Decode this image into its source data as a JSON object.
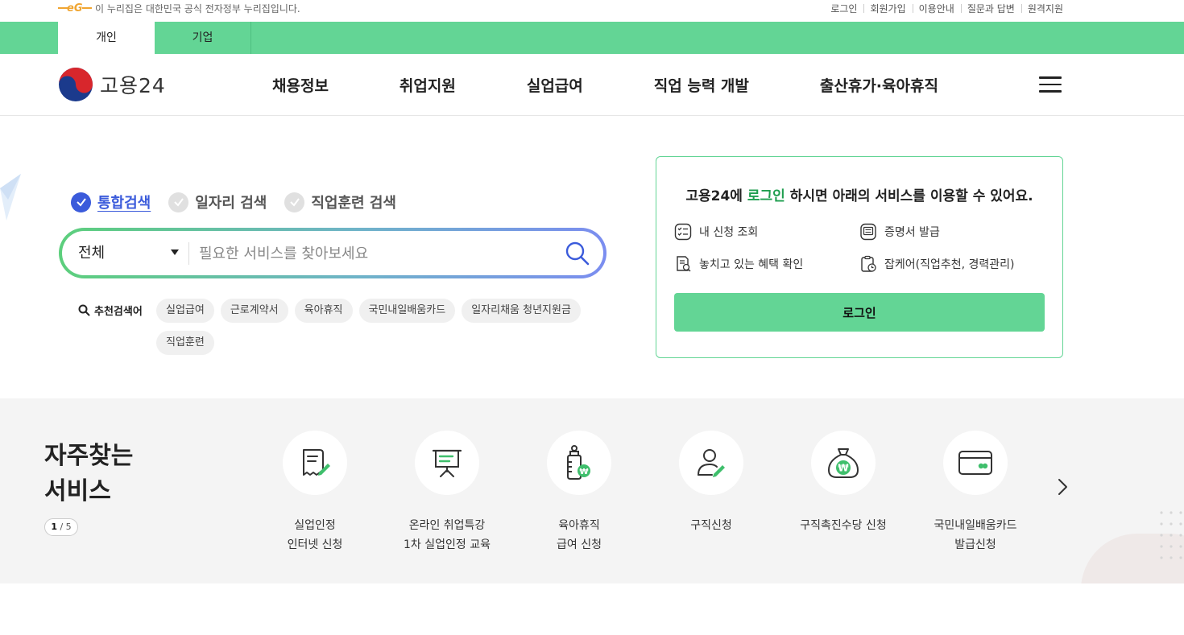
{
  "gov_bar": {
    "logo_text": "eG",
    "notice": "이 누리집은 대한민국 공식 전자정부 누리집입니다.",
    "links": [
      "로그인",
      "회원가입",
      "이용안내",
      "질문과 답변",
      "원격지원"
    ]
  },
  "audience_tabs": {
    "personal": "개인",
    "business": "기업"
  },
  "header": {
    "brand": "고용24",
    "nav": [
      "채용정보",
      "취업지원",
      "실업급여",
      "직업 능력 개발",
      "출산휴가·육아휴직"
    ]
  },
  "search": {
    "tabs": [
      "통합검색",
      "일자리 검색",
      "직업훈련 검색"
    ],
    "active_tab": "통합검색",
    "select_value": "전체",
    "placeholder": "필요한 서비스를 찾아보세요",
    "recommended_label": "추천검색어",
    "recommended_tags": [
      "실업급여",
      "근로계약서",
      "육아휴직",
      "국민내일배움카드",
      "일자리채움 청년지원금",
      "직업훈련"
    ]
  },
  "login_card": {
    "msg_prefix": "고용24에 ",
    "msg_highlight": "로그인",
    "msg_suffix": " 하시면 아래의 서비스를 이용할 수 있어요.",
    "services": [
      "내 신청 조회",
      "증명서 발급",
      "놓치고 있는 혜택 확인",
      "잡케어(직업추천, 경력관리)"
    ],
    "button": "로그인"
  },
  "frequent": {
    "title_line1": "자주찾는",
    "title_line2": "서비스",
    "page_current": "1",
    "page_total": "5",
    "items": [
      {
        "label": "실업인정\n인터넷 신청",
        "icon": "document-pen-icon"
      },
      {
        "label": "온라인 취업특강\n1차 실업인정 교육",
        "icon": "presentation-board-icon"
      },
      {
        "label": "육아휴직\n급여 신청",
        "icon": "baby-bottle-won-icon"
      },
      {
        "label": "구직신청",
        "icon": "person-pen-icon"
      },
      {
        "label": "구직촉진수당 신청",
        "icon": "money-bag-won-icon"
      },
      {
        "label": "국민내일배움카드\n발급신청",
        "icon": "card-icon"
      }
    ]
  },
  "colors": {
    "brand_green": "#63d595",
    "text_green": "#1f9e4f",
    "active_blue": "#3b5bdb",
    "gov_orange": "#f0a531"
  }
}
